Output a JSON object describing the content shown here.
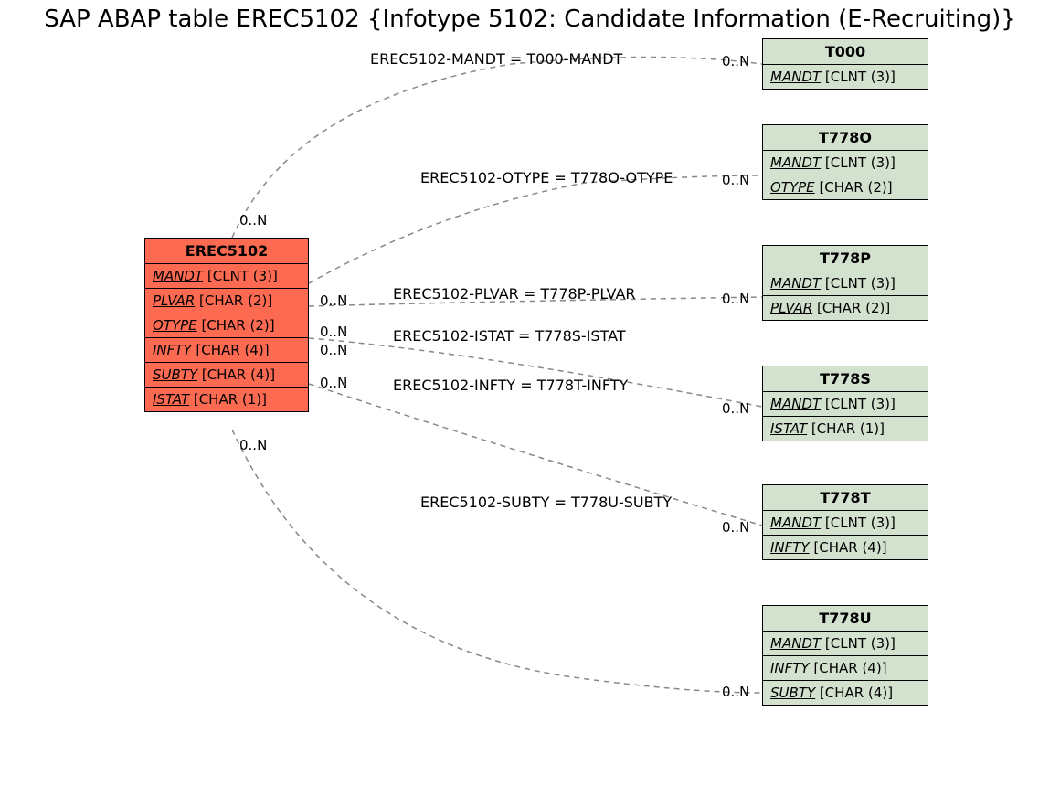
{
  "title": "SAP ABAP table EREC5102 {Infotype 5102: Candidate Information (E-Recruiting)}",
  "cardinality": "0..N",
  "main_table": {
    "name": "EREC5102",
    "fields": [
      {
        "name": "MANDT",
        "type": "[CLNT (3)]"
      },
      {
        "name": "PLVAR",
        "type": "[CHAR (2)]"
      },
      {
        "name": "OTYPE",
        "type": "[CHAR (2)]"
      },
      {
        "name": "INFTY",
        "type": "[CHAR (4)]"
      },
      {
        "name": "SUBTY",
        "type": "[CHAR (4)]"
      },
      {
        "name": "ISTAT",
        "type": "[CHAR (1)]"
      }
    ]
  },
  "ref_tables": {
    "t000": {
      "name": "T000",
      "fields": [
        {
          "name": "MANDT",
          "type": "[CLNT (3)]"
        }
      ]
    },
    "t778o": {
      "name": "T778O",
      "fields": [
        {
          "name": "MANDT",
          "type": "[CLNT (3)]"
        },
        {
          "name": "OTYPE",
          "type": "[CHAR (2)]"
        }
      ]
    },
    "t778p": {
      "name": "T778P",
      "fields": [
        {
          "name": "MANDT",
          "type": "[CLNT (3)]"
        },
        {
          "name": "PLVAR",
          "type": "[CHAR (2)]"
        }
      ]
    },
    "t778s": {
      "name": "T778S",
      "fields": [
        {
          "name": "MANDT",
          "type": "[CLNT (3)]"
        },
        {
          "name": "ISTAT",
          "type": "[CHAR (1)]"
        }
      ]
    },
    "t778t": {
      "name": "T778T",
      "fields": [
        {
          "name": "MANDT",
          "type": "[CLNT (3)]"
        },
        {
          "name": "INFTY",
          "type": "[CHAR (4)]"
        }
      ]
    },
    "t778u": {
      "name": "T778U",
      "fields": [
        {
          "name": "MANDT",
          "type": "[CLNT (3)]"
        },
        {
          "name": "INFTY",
          "type": "[CHAR (4)]"
        },
        {
          "name": "SUBTY",
          "type": "[CHAR (4)]"
        }
      ]
    }
  },
  "relations": {
    "r1": "EREC5102-MANDT = T000-MANDT",
    "r2": "EREC5102-OTYPE = T778O-OTYPE",
    "r3": "EREC5102-PLVAR = T778P-PLVAR",
    "r4": "EREC5102-ISTAT = T778S-ISTAT",
    "r5": "EREC5102-INFTY = T778T-INFTY",
    "r6": "EREC5102-SUBTY = T778U-SUBTY"
  }
}
